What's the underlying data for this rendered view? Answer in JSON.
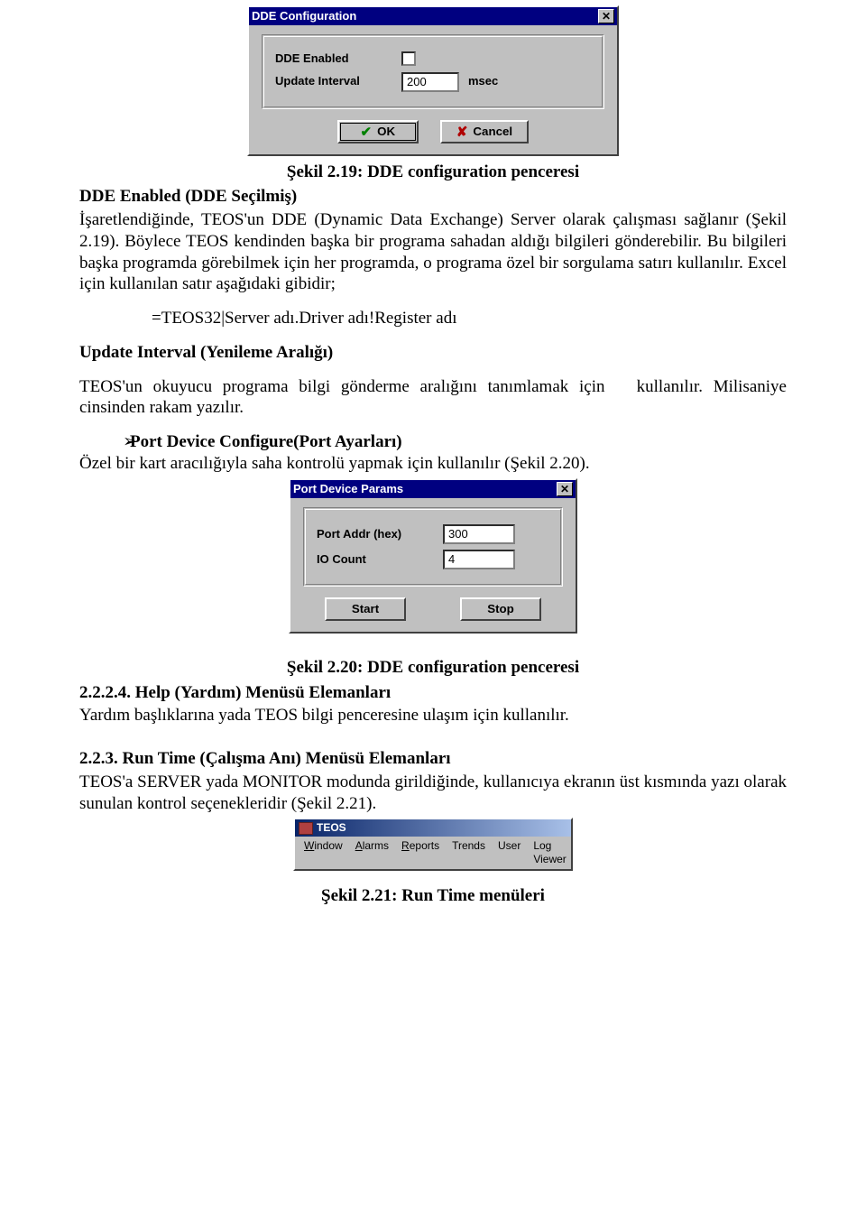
{
  "dialog1": {
    "title": "DDE Configuration",
    "dde_enabled_label": "DDE Enabled",
    "update_interval_label": "Update Interval",
    "update_interval_value": "200",
    "unit": "msec",
    "ok_label": "OK",
    "cancel_label": "Cancel"
  },
  "caption1": "Şekil 2.19: DDE configuration penceresi",
  "h_dde_enabled": "DDE Enabled (DDE Seçilmiş)",
  "p_dde_enabled": "İşaretlendiğinde, TEOS'un DDE (Dynamic Data Exchange) Server olarak çalışması sağlanır (Şekil 2.19). Böylece TEOS kendinden başka bir programa sahadan aldığı bilgileri gönderebilir. Bu bilgileri başka programda görebilmek için her programda, o programa özel bir sorgulama satırı kullanılır. Excel için kullanılan satır aşağıdaki gibidir;",
  "excel_line": "=TEOS32|Server adı.Driver adı!Register adı",
  "h_update_interval": "Update Interval (Yenileme Aralığı)",
  "p_update_interval_a": "TEOS'un okuyucu programa bilgi gönderme aralığını tanımlamak için",
  "p_update_interval_b": "kullanılır. Milisaniye cinsinden rakam yazılır.",
  "bullet_head": "Port Device Configure(Port Ayarları)",
  "bullet_body": "Özel bir kart aracılığıyla saha kontrolü yapmak için kullanılır (Şekil 2.20).",
  "dialog2": {
    "title": "Port Device Params",
    "port_addr_label": "Port Addr (hex)",
    "port_addr_value": "300",
    "io_count_label": "IO Count",
    "io_count_value": "4",
    "start_label": "Start",
    "stop_label": "Stop"
  },
  "caption2": "Şekil 2.20: DDE configuration penceresi",
  "h_224": "2.2.2.4. Help (Yardım) Menüsü Elemanları",
  "p_224": "Yardım başlıklarına yada TEOS bilgi penceresine ulaşım için kullanılır.",
  "h_223": "2.2.3. Run Time (Çalışma Anı) Menüsü Elemanları",
  "p_223": "TEOS'a SERVER yada MONITOR modunda girildiğinde, kullanıcıya ekranın üst kısmında yazı olarak sunulan kontrol seçenekleridir (Şekil 2.21).",
  "menubar": {
    "title": "TEOS",
    "items": [
      "Window",
      "Alarms",
      "Reports",
      "Trends",
      "User",
      "Log Viewer"
    ]
  },
  "caption3": "Şekil 2.21: Run Time menüleri"
}
